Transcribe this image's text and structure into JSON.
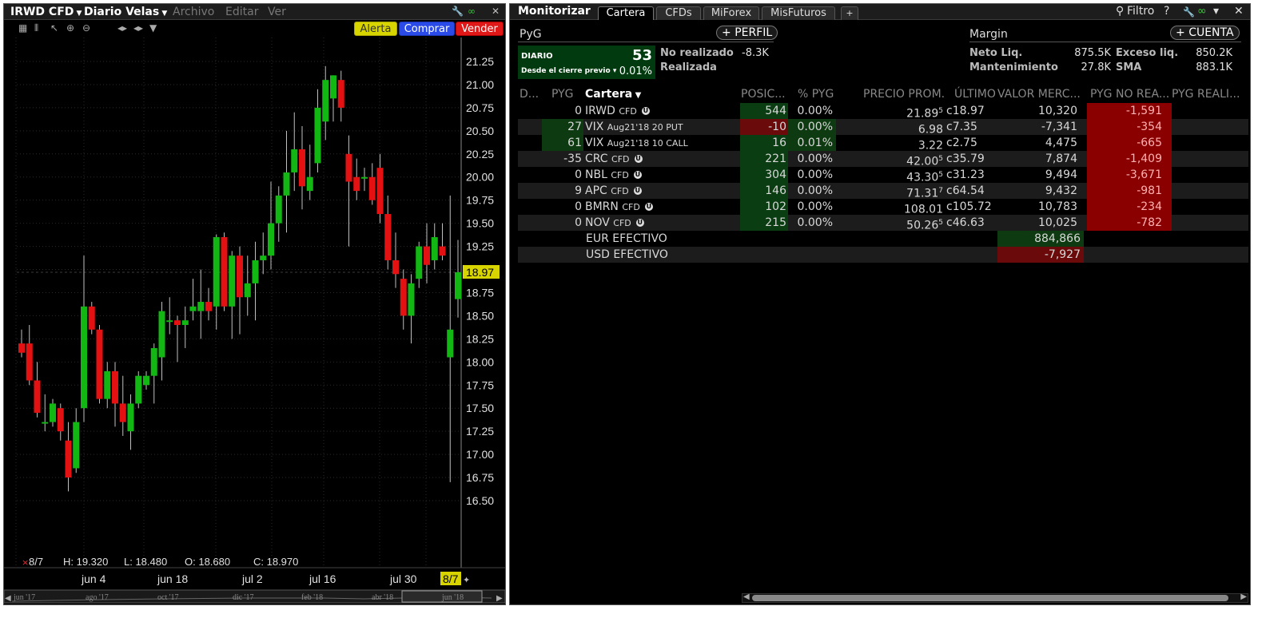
{
  "chart_window": {
    "symbol": "IRWD CFD",
    "period": "Diario Velas",
    "menu": [
      "Archivo",
      "Editar",
      "Ver"
    ],
    "buttons": {
      "alert": "Alerta",
      "buy": "Comprar",
      "sell": "Vender"
    },
    "ohlc": {
      "date": "8/7",
      "h": "H: 19.320",
      "l": "L: 18.480",
      "o": "O: 18.680",
      "c": "C: 18.970"
    },
    "current_price_label": "18.97",
    "current_date_label": "8/7",
    "x_labels": [
      "jun 4",
      "jun 18",
      "jul 2",
      "jul 16",
      "jul 30"
    ],
    "timeline_labels": [
      "jun '17",
      "ago '17",
      "oct '17",
      "dic '17",
      "feb '18",
      "abr '18",
      "jun '18"
    ],
    "colors": {
      "up": "#13b713",
      "down": "#e31111",
      "grid": "#2a2a2a",
      "wick": "#bfbfbf"
    }
  },
  "chart_data": {
    "type": "candlestick",
    "y_ticks": [
      "21.25",
      "21.00",
      "20.75",
      "20.50",
      "20.25",
      "20.00",
      "19.75",
      "19.50",
      "19.25",
      "19.00",
      "18.75",
      "18.50",
      "18.25",
      "18.00",
      "17.75",
      "17.50",
      "17.25",
      "17.00",
      "16.75",
      "16.50"
    ],
    "ylim": [
      16.43,
      21.4
    ],
    "candles": [
      {
        "o": 18.2,
        "h": 18.35,
        "l": 18.05,
        "c": 18.1
      },
      {
        "o": 18.2,
        "h": 18.4,
        "l": 17.75,
        "c": 17.8
      },
      {
        "o": 17.8,
        "h": 18.0,
        "l": 17.4,
        "c": 17.45
      },
      {
        "o": 17.35,
        "h": 17.65,
        "l": 17.25,
        "c": 17.35
      },
      {
        "o": 17.35,
        "h": 17.6,
        "l": 17.3,
        "c": 17.55
      },
      {
        "o": 17.5,
        "h": 17.55,
        "l": 17.15,
        "c": 17.25
      },
      {
        "o": 17.15,
        "h": 17.35,
        "l": 16.6,
        "c": 16.75
      },
      {
        "o": 16.85,
        "h": 17.5,
        "l": 16.8,
        "c": 17.35
      },
      {
        "o": 17.5,
        "h": 19.15,
        "l": 17.35,
        "c": 18.6
      },
      {
        "o": 18.6,
        "h": 18.65,
        "l": 18.3,
        "c": 18.35
      },
      {
        "o": 18.35,
        "h": 18.4,
        "l": 17.55,
        "c": 17.6
      },
      {
        "o": 17.6,
        "h": 18.0,
        "l": 17.5,
        "c": 17.9
      },
      {
        "o": 17.9,
        "h": 18.0,
        "l": 17.3,
        "c": 17.55
      },
      {
        "o": 17.55,
        "h": 17.85,
        "l": 17.2,
        "c": 17.35
      },
      {
        "o": 17.25,
        "h": 17.65,
        "l": 17.05,
        "c": 17.55
      },
      {
        "o": 17.55,
        "h": 17.9,
        "l": 17.5,
        "c": 17.85
      },
      {
        "o": 17.75,
        "h": 17.9,
        "l": 17.7,
        "c": 17.85
      },
      {
        "o": 17.85,
        "h": 18.2,
        "l": 17.55,
        "c": 18.15
      },
      {
        "o": 18.05,
        "h": 18.65,
        "l": 17.8,
        "c": 18.55
      },
      {
        "o": 18.45,
        "h": 18.7,
        "l": 18.3,
        "c": 18.45
      },
      {
        "o": 18.45,
        "h": 18.5,
        "l": 18.0,
        "c": 18.4
      },
      {
        "o": 18.4,
        "h": 18.6,
        "l": 18.15,
        "c": 18.45
      },
      {
        "o": 18.55,
        "h": 18.9,
        "l": 18.45,
        "c": 18.6
      },
      {
        "o": 18.55,
        "h": 19.0,
        "l": 18.25,
        "c": 18.65
      },
      {
        "o": 18.65,
        "h": 18.8,
        "l": 18.45,
        "c": 18.55
      },
      {
        "o": 18.6,
        "h": 19.38,
        "l": 18.35,
        "c": 19.35
      },
      {
        "o": 19.35,
        "h": 19.4,
        "l": 18.55,
        "c": 18.6
      },
      {
        "o": 18.6,
        "h": 19.2,
        "l": 18.25,
        "c": 19.15
      },
      {
        "o": 19.15,
        "h": 19.25,
        "l": 18.3,
        "c": 18.7
      },
      {
        "o": 18.7,
        "h": 19.15,
        "l": 18.5,
        "c": 18.85
      },
      {
        "o": 18.85,
        "h": 19.3,
        "l": 18.45,
        "c": 19.1
      },
      {
        "o": 19.1,
        "h": 19.4,
        "l": 18.95,
        "c": 19.15
      },
      {
        "o": 19.15,
        "h": 19.95,
        "l": 19.0,
        "c": 19.5
      },
      {
        "o": 19.5,
        "h": 19.9,
        "l": 19.3,
        "c": 19.8
      },
      {
        "o": 19.8,
        "h": 20.5,
        "l": 19.4,
        "c": 20.05
      },
      {
        "o": 20.05,
        "h": 20.7,
        "l": 19.85,
        "c": 20.3
      },
      {
        "o": 20.3,
        "h": 20.55,
        "l": 19.65,
        "c": 19.9
      },
      {
        "o": 19.85,
        "h": 20.35,
        "l": 19.75,
        "c": 20.0
      },
      {
        "o": 20.15,
        "h": 20.95,
        "l": 20.05,
        "c": 20.75
      },
      {
        "o": 20.6,
        "h": 21.2,
        "l": 20.4,
        "c": 21.05
      },
      {
        "o": 20.85,
        "h": 21.1,
        "l": 20.6,
        "c": 21.1
      },
      {
        "o": 21.05,
        "h": 21.15,
        "l": 20.6,
        "c": 20.75
      },
      {
        "o": 20.25,
        "h": 20.45,
        "l": 19.25,
        "c": 19.95
      },
      {
        "o": 20.0,
        "h": 20.2,
        "l": 19.75,
        "c": 19.85
      },
      {
        "o": 20.0,
        "h": 20.1,
        "l": 19.85,
        "c": 20.0
      },
      {
        "o": 20.0,
        "h": 20.15,
        "l": 19.7,
        "c": 19.75
      },
      {
        "o": 20.1,
        "h": 20.25,
        "l": 19.5,
        "c": 19.6
      },
      {
        "o": 19.6,
        "h": 19.8,
        "l": 19.0,
        "c": 19.1
      },
      {
        "o": 19.1,
        "h": 19.4,
        "l": 18.8,
        "c": 18.95
      },
      {
        "o": 18.9,
        "h": 19.0,
        "l": 18.35,
        "c": 18.5
      },
      {
        "o": 18.5,
        "h": 18.95,
        "l": 18.2,
        "c": 18.85
      },
      {
        "o": 18.9,
        "h": 19.3,
        "l": 18.8,
        "c": 19.25
      },
      {
        "o": 19.25,
        "h": 19.5,
        "l": 18.85,
        "c": 19.05
      },
      {
        "o": 19.1,
        "h": 19.5,
        "l": 19.0,
        "c": 19.35
      },
      {
        "o": 19.25,
        "h": 19.5,
        "l": 19.1,
        "c": 19.15
      },
      {
        "o": 18.05,
        "h": 19.8,
        "l": 16.7,
        "c": 18.35
      },
      {
        "o": 18.68,
        "h": 19.32,
        "l": 18.48,
        "c": 18.97
      }
    ]
  },
  "monitor": {
    "title": "Monitorizar",
    "tabs": [
      "Cartera",
      "CFDs",
      "MiForex",
      "MisFuturos",
      "+"
    ],
    "filter_label": "Filtro",
    "help_label": "?",
    "pyg": {
      "label": "PyG",
      "profile_button": "PERFIL",
      "daily_label": "DIARIO",
      "daily_value": "53",
      "since_label": "Desde el cierre previo",
      "since_pct": "0.01%",
      "unrealized_label": "No realizado",
      "unrealized_value": "-8.3K",
      "realized_label": "Realizada"
    },
    "margin": {
      "label": "Margin",
      "account_button": "CUENTA",
      "net_liq_label": "Neto Liq.",
      "net_liq_value": "875.5K",
      "excess_label": "Exceso liq.",
      "excess_value": "850.2K",
      "maint_label": "Mantenimiento",
      "maint_value": "27.8K",
      "sma_label": "SMA",
      "sma_value": "883.1K"
    },
    "columns": [
      "D...",
      "PYG",
      "Cartera",
      "POSIC...",
      "% PYG",
      "PRECIO PROM.",
      "ÚLTIMO",
      "VALOR MERC...",
      "PYG NO REA...",
      "PYG REALI..."
    ],
    "rows": [
      {
        "pyg": "0",
        "sym": "IRWD",
        "desc": "CFD",
        "pos": "544",
        "pct": "0.00%",
        "avg": "21.89",
        "avg_sup": "5",
        "last": "c18.97",
        "mkt": "10,320",
        "unr": "-1,591",
        "pyg_bg": "none",
        "pos_bg": "green"
      },
      {
        "pyg": "27",
        "sym": "VIX",
        "desc": "Aug21'18 20 PUT",
        "pos": "-10",
        "pct": "0.00%",
        "avg": "6.98",
        "avg_sup": "",
        "last": "c7.35",
        "mkt": "-7,341",
        "unr": "-354",
        "pyg_bg": "green",
        "pos_bg": "red"
      },
      {
        "pyg": "61",
        "sym": "VIX",
        "desc": "Aug21'18 10 CALL",
        "pos": "16",
        "pct": "0.01%",
        "avg": "3.22",
        "avg_sup": "",
        "last": "c2.75",
        "mkt": "4,475",
        "unr": "-665",
        "pyg_bg": "green",
        "pos_bg": "green"
      },
      {
        "pyg": "-35",
        "sym": "CRC",
        "desc": "CFD",
        "pos": "221",
        "pct": "0.00%",
        "avg": "42.00",
        "avg_sup": "5",
        "last": "c35.79",
        "mkt": "7,874",
        "unr": "-1,409",
        "pyg_bg": "none",
        "pos_bg": "green"
      },
      {
        "pyg": "0",
        "sym": "NBL",
        "desc": "CFD",
        "pos": "304",
        "pct": "0.00%",
        "avg": "43.30",
        "avg_sup": "5",
        "last": "c31.23",
        "mkt": "9,494",
        "unr": "-3,671",
        "pyg_bg": "none",
        "pos_bg": "green"
      },
      {
        "pyg": "9",
        "sym": "APC",
        "desc": "CFD",
        "pos": "146",
        "pct": "0.00%",
        "avg": "71.31",
        "avg_sup": "7",
        "last": "c64.54",
        "mkt": "9,432",
        "unr": "-981",
        "pyg_bg": "none",
        "pos_bg": "green"
      },
      {
        "pyg": "0",
        "sym": "BMRN",
        "desc": "CFD",
        "pos": "102",
        "pct": "0.00%",
        "avg": "108.01",
        "avg_sup": "",
        "last": "c105.72",
        "mkt": "10,783",
        "unr": "-234",
        "pyg_bg": "none",
        "pos_bg": "green"
      },
      {
        "pyg": "0",
        "sym": "NOV",
        "desc": "CFD",
        "pos": "215",
        "pct": "0.00%",
        "avg": "50.26",
        "avg_sup": "5",
        "last": "c46.63",
        "mkt": "10,025",
        "unr": "-782",
        "pyg_bg": "none",
        "pos_bg": "green"
      }
    ],
    "cash_rows": [
      {
        "label": "EUR EFECTIVO",
        "value": "884,866",
        "bg": "green"
      },
      {
        "label": "USD EFECTIVO",
        "value": "-7,927",
        "bg": "red"
      }
    ]
  }
}
